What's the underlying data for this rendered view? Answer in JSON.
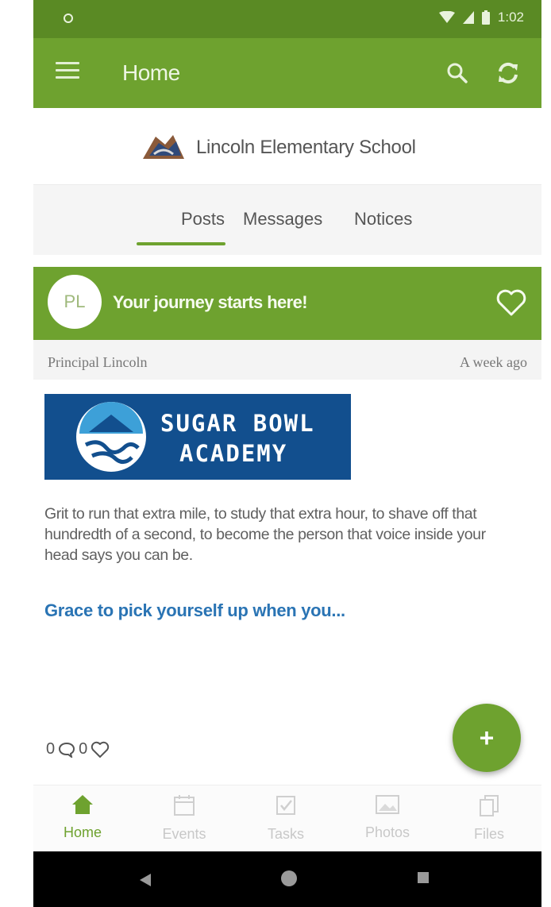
{
  "status_bar": {
    "time": "1:02"
  },
  "app_bar": {
    "title": "Home",
    "icons": [
      "menu-icon",
      "search-icon",
      "refresh-icon"
    ]
  },
  "school": {
    "name": "Lincoln Elementary School"
  },
  "tabs": [
    {
      "label": "Posts",
      "active": true
    },
    {
      "label": "Messages",
      "active": false
    },
    {
      "label": "Notices",
      "active": false
    }
  ],
  "post": {
    "avatar_initials": "PL",
    "title": "Your journey starts here!",
    "author": "Principal Lincoln",
    "time": "A week ago",
    "banner_line1": "SUGAR BOWL",
    "banner_line2": "ACADEMY",
    "body": "Grit to run that extra mile, to study that extra hour, to shave off that hundredth of a second, to become the person that voice inside your head says you can be.",
    "read_more": "Grace to pick yourself up when you...",
    "comment_count": "0",
    "like_count": "0"
  },
  "fab": {
    "label": "+"
  },
  "bottom_nav": [
    {
      "label": "Home",
      "icon": "home-icon",
      "active": true
    },
    {
      "label": "Events",
      "icon": "calendar-icon",
      "active": false
    },
    {
      "label": "Tasks",
      "icon": "tasks-icon",
      "active": false
    },
    {
      "label": "Photos",
      "icon": "photos-icon",
      "active": false
    },
    {
      "label": "Files",
      "icon": "files-icon",
      "active": false
    }
  ],
  "colors": {
    "primary": "#6ea22f",
    "status_bar": "#5a8a24",
    "link": "#2a74b4",
    "banner": "#124f8e"
  }
}
